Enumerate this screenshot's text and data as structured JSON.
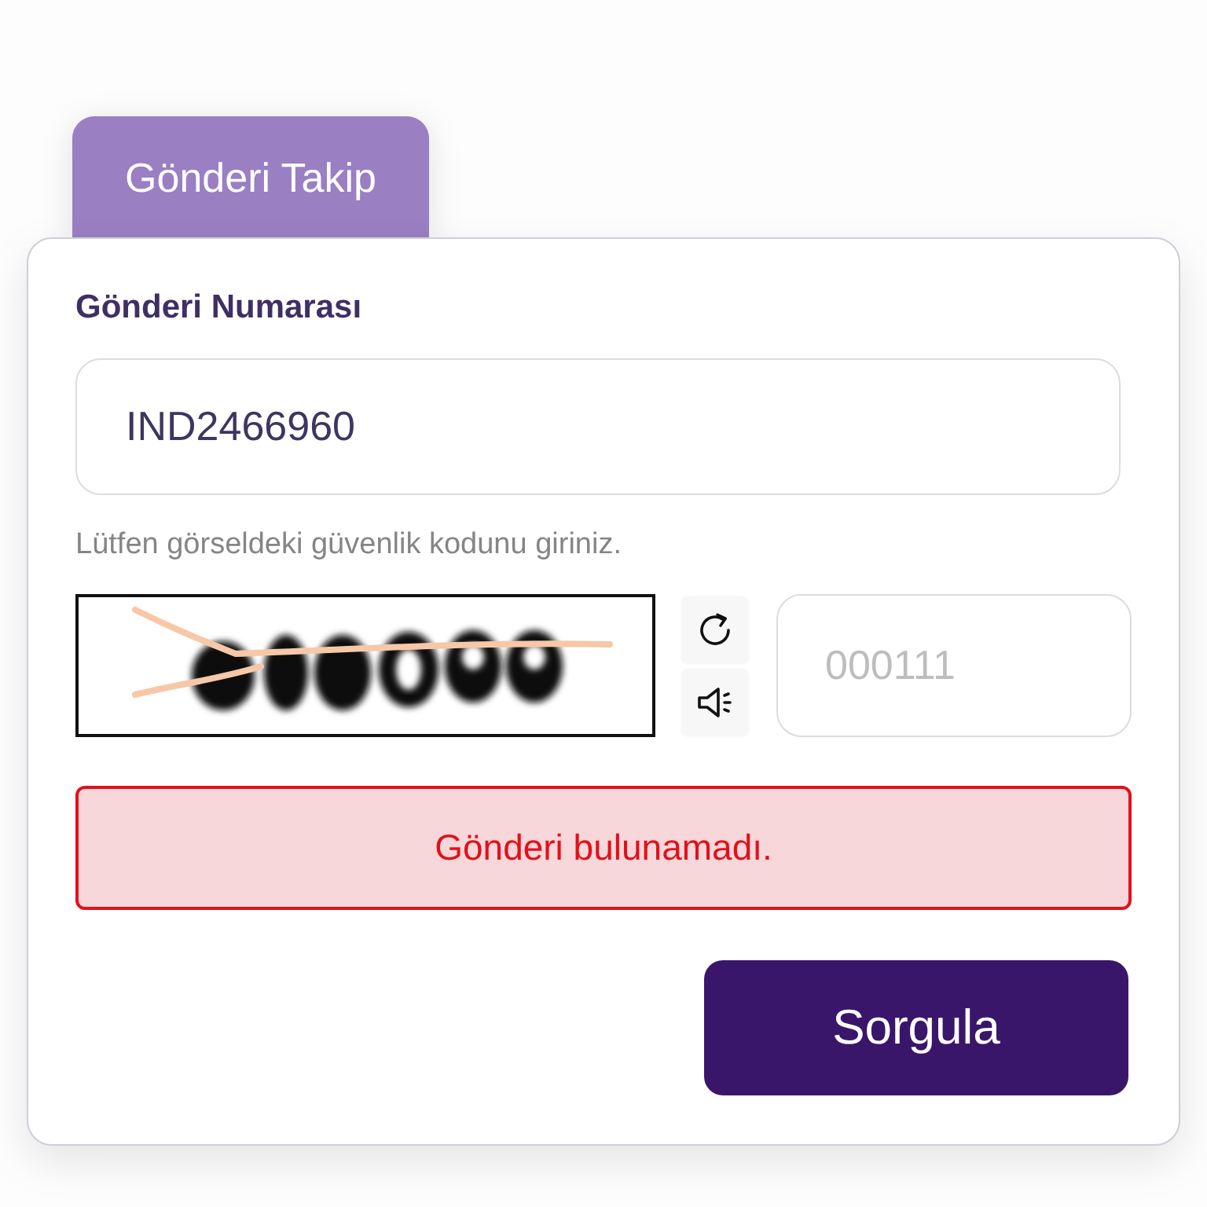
{
  "tabs": [
    {
      "label": "Gönderi Takip",
      "selected": true
    }
  ],
  "form": {
    "tracking_number": {
      "label": "Gönderi Numarası",
      "value": "IND2466960"
    },
    "captcha": {
      "hint": "Lütfen görseldeki güvenlik kodunu giriniz.",
      "code_field": {
        "placeholder": "000111"
      }
    },
    "error": {
      "message": "Gönderi bulunamadı."
    },
    "submit_button": "Sorgula"
  }
}
